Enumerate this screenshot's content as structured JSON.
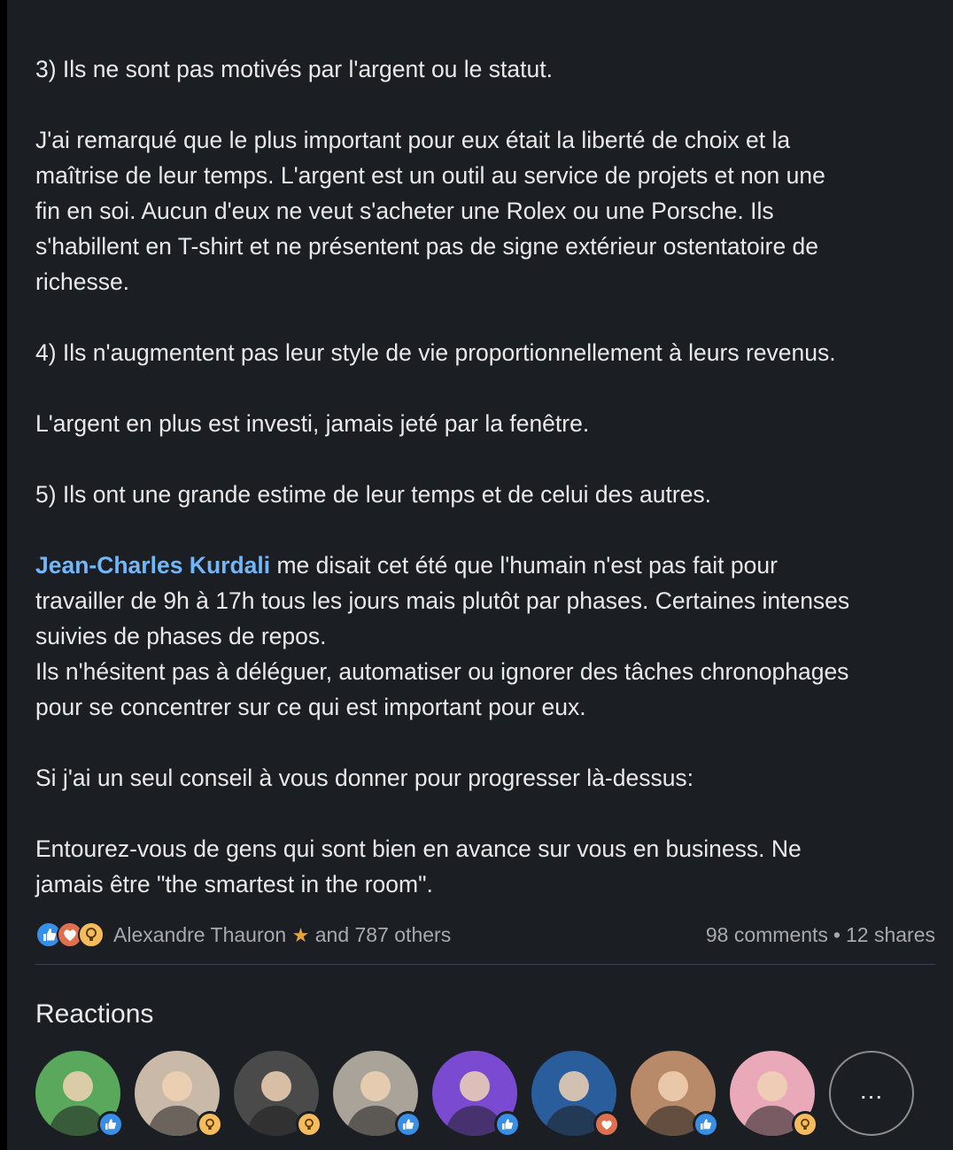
{
  "post": {
    "paragraphs": [
      {
        "lines": [
          "3) Ils ne sont pas motivés par l'argent ou le statut."
        ]
      },
      {
        "lines": [
          "J'ai remarqué que le plus important pour eux était la liberté de choix et la",
          "maîtrise de leur temps. L'argent est un outil au service de projets et non une",
          "fin en soi. Aucun d'eux ne veut s'acheter une Rolex ou une Porsche. Ils",
          "s'habillent en T-shirt et ne présentent pas de signe extérieur ostentatoire de",
          "richesse."
        ]
      },
      {
        "lines": [
          "4) Ils n'augmentent pas leur style de vie proportionnellement à leurs revenus."
        ]
      },
      {
        "lines": [
          "L'argent en plus est investi, jamais jeté par la fenêtre."
        ]
      },
      {
        "lines": [
          "5) Ils ont une grande estime de leur temps et de celui des autres."
        ]
      }
    ],
    "mention_paragraph": {
      "mention": "Jean-Charles Kurdali",
      "first_line_rest": " me disait cet été que l'humain n'est pas fait pour",
      "lines": [
        "travailler de 9h à 17h tous les jours mais plutôt par phases. Certaines intenses",
        "suivies de phases de repos.",
        "Ils n'hésitent pas à déléguer, automatiser ou ignorer des tâches chronophages",
        "pour se concentrer sur ce qui est important pour eux."
      ]
    },
    "closing": [
      {
        "lines": [
          "Si j'ai un seul conseil à vous donner pour progresser là-dessus:"
        ]
      },
      {
        "lines": [
          "Entourez-vous de gens qui sont bien en avance sur vous en business. Ne",
          "jamais être \"the smartest in the room\"."
        ]
      }
    ]
  },
  "social": {
    "reactor_name": "Alexandre Thauron",
    "star_glyph": "★",
    "others_text": "and 787 others",
    "comments": "98 comments",
    "separator": "•",
    "shares": "12 shares",
    "reaction_icons": [
      "like-icon",
      "love-icon",
      "insightful-icon"
    ]
  },
  "reactions": {
    "title": "Reactions",
    "more_label": "...",
    "people": [
      {
        "reaction": "like",
        "bg": "#5aa85c"
      },
      {
        "reaction": "insightful",
        "bg": "#c9b9a8"
      },
      {
        "reaction": "insightful",
        "bg": "#4a4a4a"
      },
      {
        "reaction": "like",
        "bg": "#a9a39a"
      },
      {
        "reaction": "like",
        "bg": "#7a4bd1"
      },
      {
        "reaction": "love",
        "bg": "#2a5d9c"
      },
      {
        "reaction": "like",
        "bg": "#b98a6a"
      },
      {
        "reaction": "insightful",
        "bg": "#e9a9b8"
      }
    ]
  },
  "colors": {
    "background": "#1b1f23",
    "text": "#e9e9ea",
    "muted": "#a8a9ab",
    "link": "#71b7fb",
    "like": "#378fe9",
    "love": "#df704d",
    "insightful": "#f5bb5c"
  }
}
